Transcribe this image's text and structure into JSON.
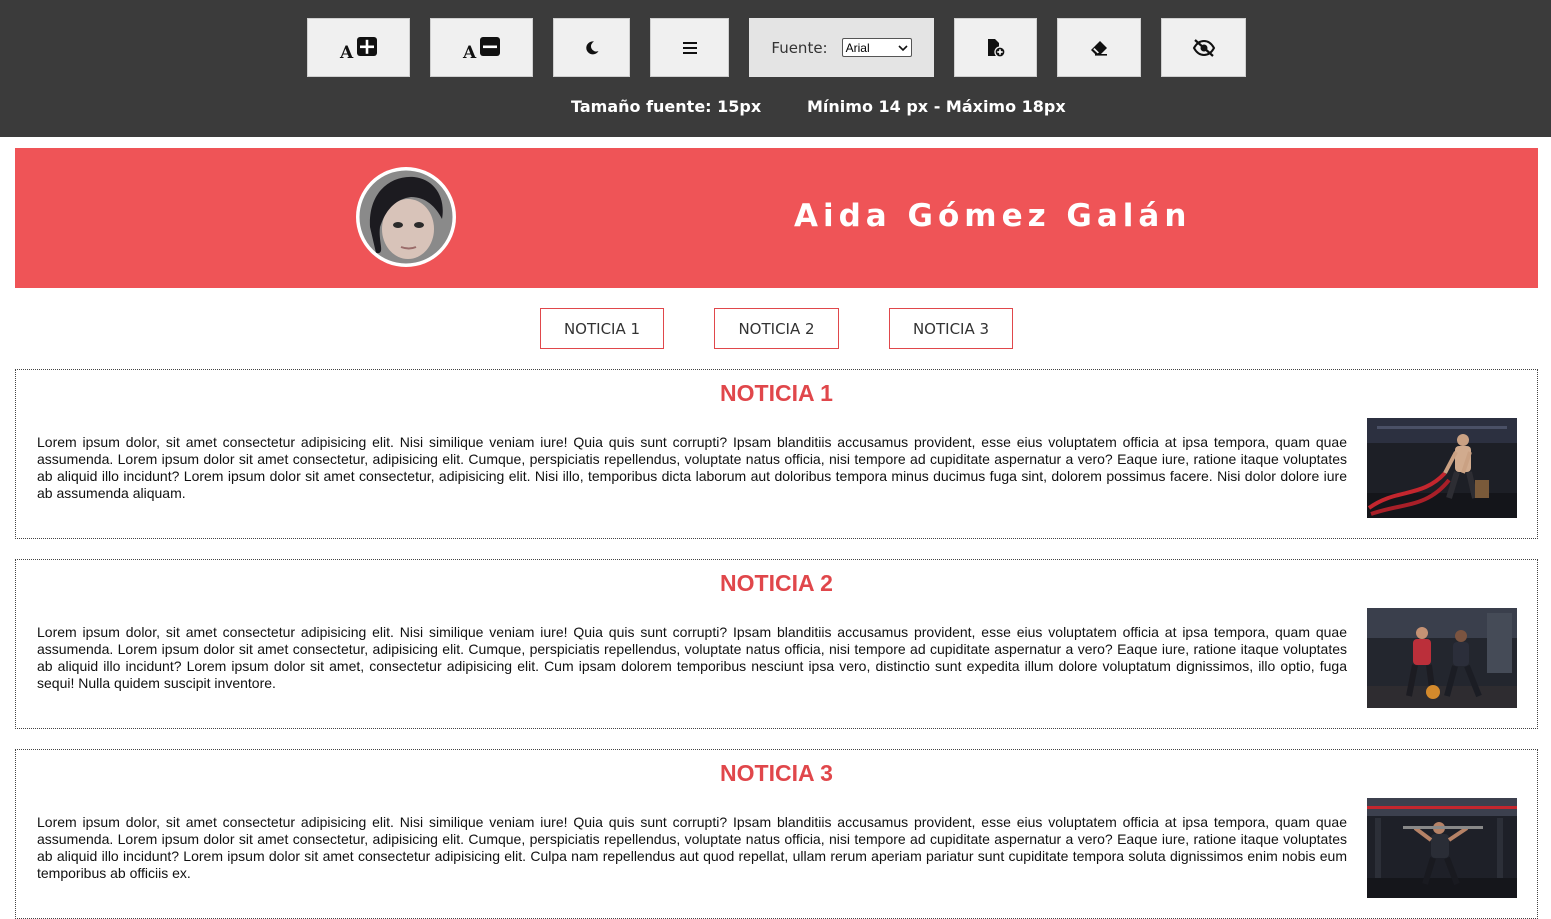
{
  "toolbar": {
    "font_label": "Fuente:",
    "font_selected": "Arial",
    "size_text": "Tamaño fuente: 15px",
    "range_text": "Mínimo 14 px - Máximo 18px",
    "icons": [
      "increase-font-icon",
      "decrease-font-icon",
      "dark-mode-icon",
      "line-spacing-icon",
      "add-page-icon",
      "eraser-icon",
      "hide-icon"
    ]
  },
  "hero": {
    "name": "Aida Gómez Galán"
  },
  "nav": [
    {
      "label": "NOTICIA 1"
    },
    {
      "label": "NOTICIA 2"
    },
    {
      "label": "NOTICIA 3"
    }
  ],
  "news": [
    {
      "title": "NOTICIA 1",
      "text": "Lorem ipsum dolor, sit amet consectetur adipisicing elit. Nisi similique veniam iure! Quia quis sunt corrupti? Ipsam blanditiis accusamus provident, esse eius voluptatem officia at ipsa tempora, quam quae assumenda. Lorem ipsum dolor sit amet consectetur, adipisicing elit. Cumque, perspiciatis repellendus, voluptate natus officia, nisi tempore ad cupiditate aspernatur a vero? Eaque iure, ratione itaque voluptates ab aliquid illo incidunt? Lorem ipsum dolor sit amet consectetur, adipisicing elit. Nisi illo, temporibus dicta laborum aut doloribus tempora minus ducimus fuga sint, dolorem possimus facere. Nisi dolor dolore iure ab assumenda aliquam."
    },
    {
      "title": "NOTICIA 2",
      "text": "Lorem ipsum dolor, sit amet consectetur adipisicing elit. Nisi similique veniam iure! Quia quis sunt corrupti? Ipsam blanditiis accusamus provident, esse eius voluptatem officia at ipsa tempora, quam quae assumenda. Lorem ipsum dolor sit amet consectetur, adipisicing elit. Cumque, perspiciatis repellendus, voluptate natus officia, nisi tempore ad cupiditate aspernatur a vero? Eaque iure, ratione itaque voluptates ab aliquid illo incidunt? Lorem ipsum dolor sit amet, consectetur adipisicing elit. Cum ipsam dolorem temporibus nesciunt ipsa vero, distinctio sunt expedita illum dolore voluptatum dignissimos, illo optio, fuga sequi! Nulla quidem suscipit inventore."
    },
    {
      "title": "NOTICIA 3",
      "text": "Lorem ipsum dolor, sit amet consectetur adipisicing elit. Nisi similique veniam iure! Quia quis sunt corrupti? Ipsam blanditiis accusamus provident, esse eius voluptatem officia at ipsa tempora, quam quae assumenda. Lorem ipsum dolor sit amet consectetur, adipisicing elit. Cumque, perspiciatis repellendus, voluptate natus officia, nisi tempore ad cupiditate aspernatur a vero? Eaque iure, ratione itaque voluptates ab aliquid illo incidunt? Lorem ipsum dolor sit amet consectetur adipisicing elit. Culpa nam repellendus aut quod repellat, ullam rerum aperiam pariatur sunt cupiditate tempora soluta dignissimos enim nobis eum temporibus ab officiis ex."
    }
  ],
  "colors": {
    "toolbar_bg": "#3b3b3b",
    "accent": "#ef5457",
    "title_red": "#e0474b"
  }
}
